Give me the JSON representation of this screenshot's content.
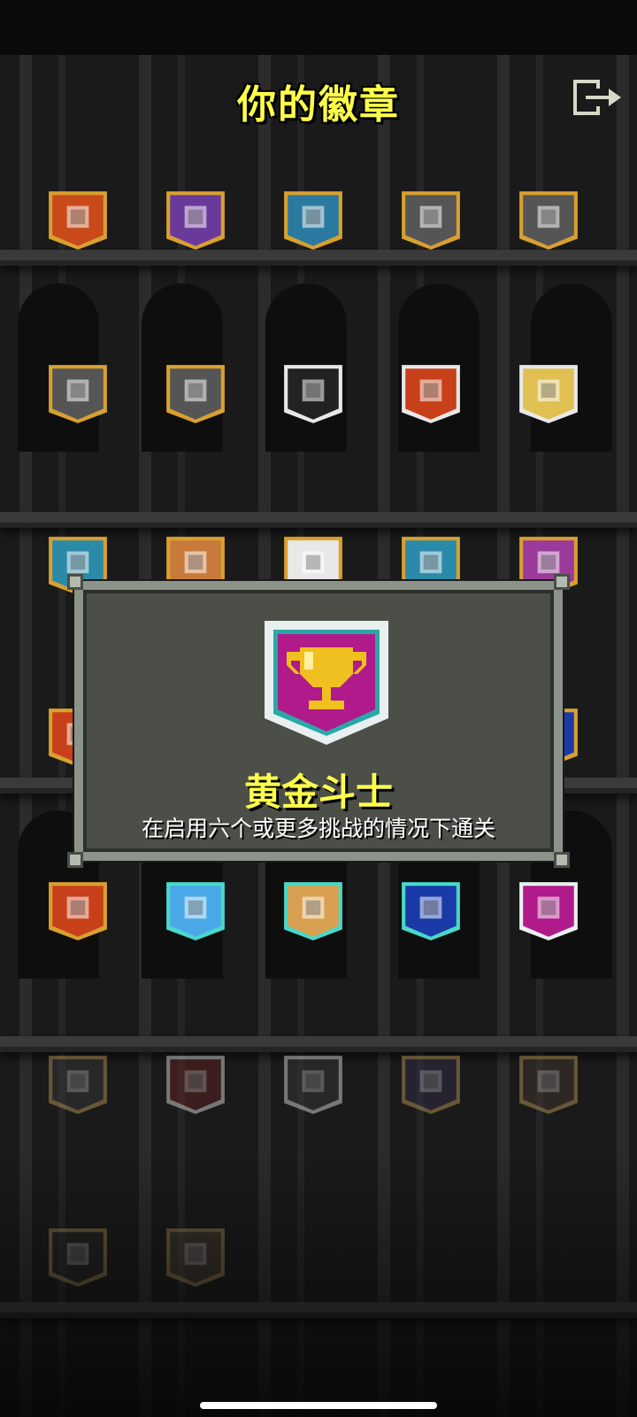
{
  "header": {
    "title": "你的徽章",
    "exit_icon": "exit-arrow-icon"
  },
  "badges": [
    {
      "icon": "warrior-face-icon",
      "frame": "gold",
      "fill": "#c84a1a"
    },
    {
      "icon": "mage-face-icon",
      "frame": "gold",
      "fill": "#6a3a9a"
    },
    {
      "icon": "huntress-face-icon",
      "frame": "gold",
      "fill": "#2a7aa0"
    },
    {
      "icon": "flame-icon",
      "frame": "gold",
      "fill": "#555555"
    },
    {
      "icon": "potion-icon",
      "frame": "gold",
      "fill": "#555555"
    },
    {
      "icon": "skull-icon",
      "frame": "gold",
      "fill": "#555555"
    },
    {
      "icon": "seed-icon",
      "frame": "gold",
      "fill": "#555555"
    },
    {
      "icon": "skull-icon",
      "frame": "silver",
      "fill": "#222222"
    },
    {
      "icon": "cross-icon",
      "frame": "silver",
      "fill": "#c8401a"
    },
    {
      "icon": "face-icon",
      "frame": "silver",
      "fill": "#e0c050"
    },
    {
      "icon": "lizard-icon",
      "frame": "gold",
      "fill": "#2a8aa8"
    },
    {
      "icon": "armor-icon",
      "frame": "gold",
      "fill": "#c87a3a"
    },
    {
      "icon": "teeth-icon",
      "frame": "gold",
      "fill": "#e8e8e8"
    },
    {
      "icon": "sword-icon",
      "frame": "gold",
      "fill": "#2a8aa8"
    },
    {
      "icon": "scroll-icon",
      "frame": "gold",
      "fill": "#9a3a9a"
    },
    {
      "icon": "cross-icon",
      "frame": "gold",
      "fill": "#c8401a"
    },
    {
      "icon": "gem-icon",
      "frame": "gold",
      "fill": "#1a3aa8"
    },
    {
      "icon": "cross-icon",
      "frame": "gold",
      "fill": "#c8401a"
    },
    {
      "icon": "cloud-icon",
      "frame": "teal",
      "fill": "#4aa8e8"
    },
    {
      "icon": "door-icon",
      "frame": "teal",
      "fill": "#d8a050"
    },
    {
      "icon": "gem-icon",
      "frame": "teal",
      "fill": "#1a3aa8"
    },
    {
      "icon": "trophy-icon",
      "frame": "silver-teal",
      "fill": "#b01a8a"
    },
    {
      "icon": "character-icon",
      "frame": "gold",
      "fill": "#3a3a3a"
    },
    {
      "icon": "mask-icon",
      "frame": "silver",
      "fill": "#8a1a1a"
    },
    {
      "icon": "heart-icon",
      "frame": "silver",
      "fill": "#3a3a3a"
    },
    {
      "icon": "arrow-up-icon",
      "frame": "gold",
      "fill": "#3a2a5a"
    },
    {
      "icon": "seed-icon",
      "frame": "gold",
      "fill": "#4a3a2a"
    },
    {
      "icon": "tombstone-icon",
      "frame": "gold",
      "fill": "#2a2a2a"
    },
    {
      "icon": "chest-icon",
      "frame": "gold",
      "fill": "#5a4a2a"
    }
  ],
  "modal": {
    "badge_icon": "trophy-icon",
    "title": "黄金斗士",
    "description": "在启用六个或更多挑战的情况下通关"
  },
  "colors": {
    "title_yellow": "#ffff4a",
    "modal_bg": "#4c4f48",
    "modal_border": "#8c948a"
  }
}
